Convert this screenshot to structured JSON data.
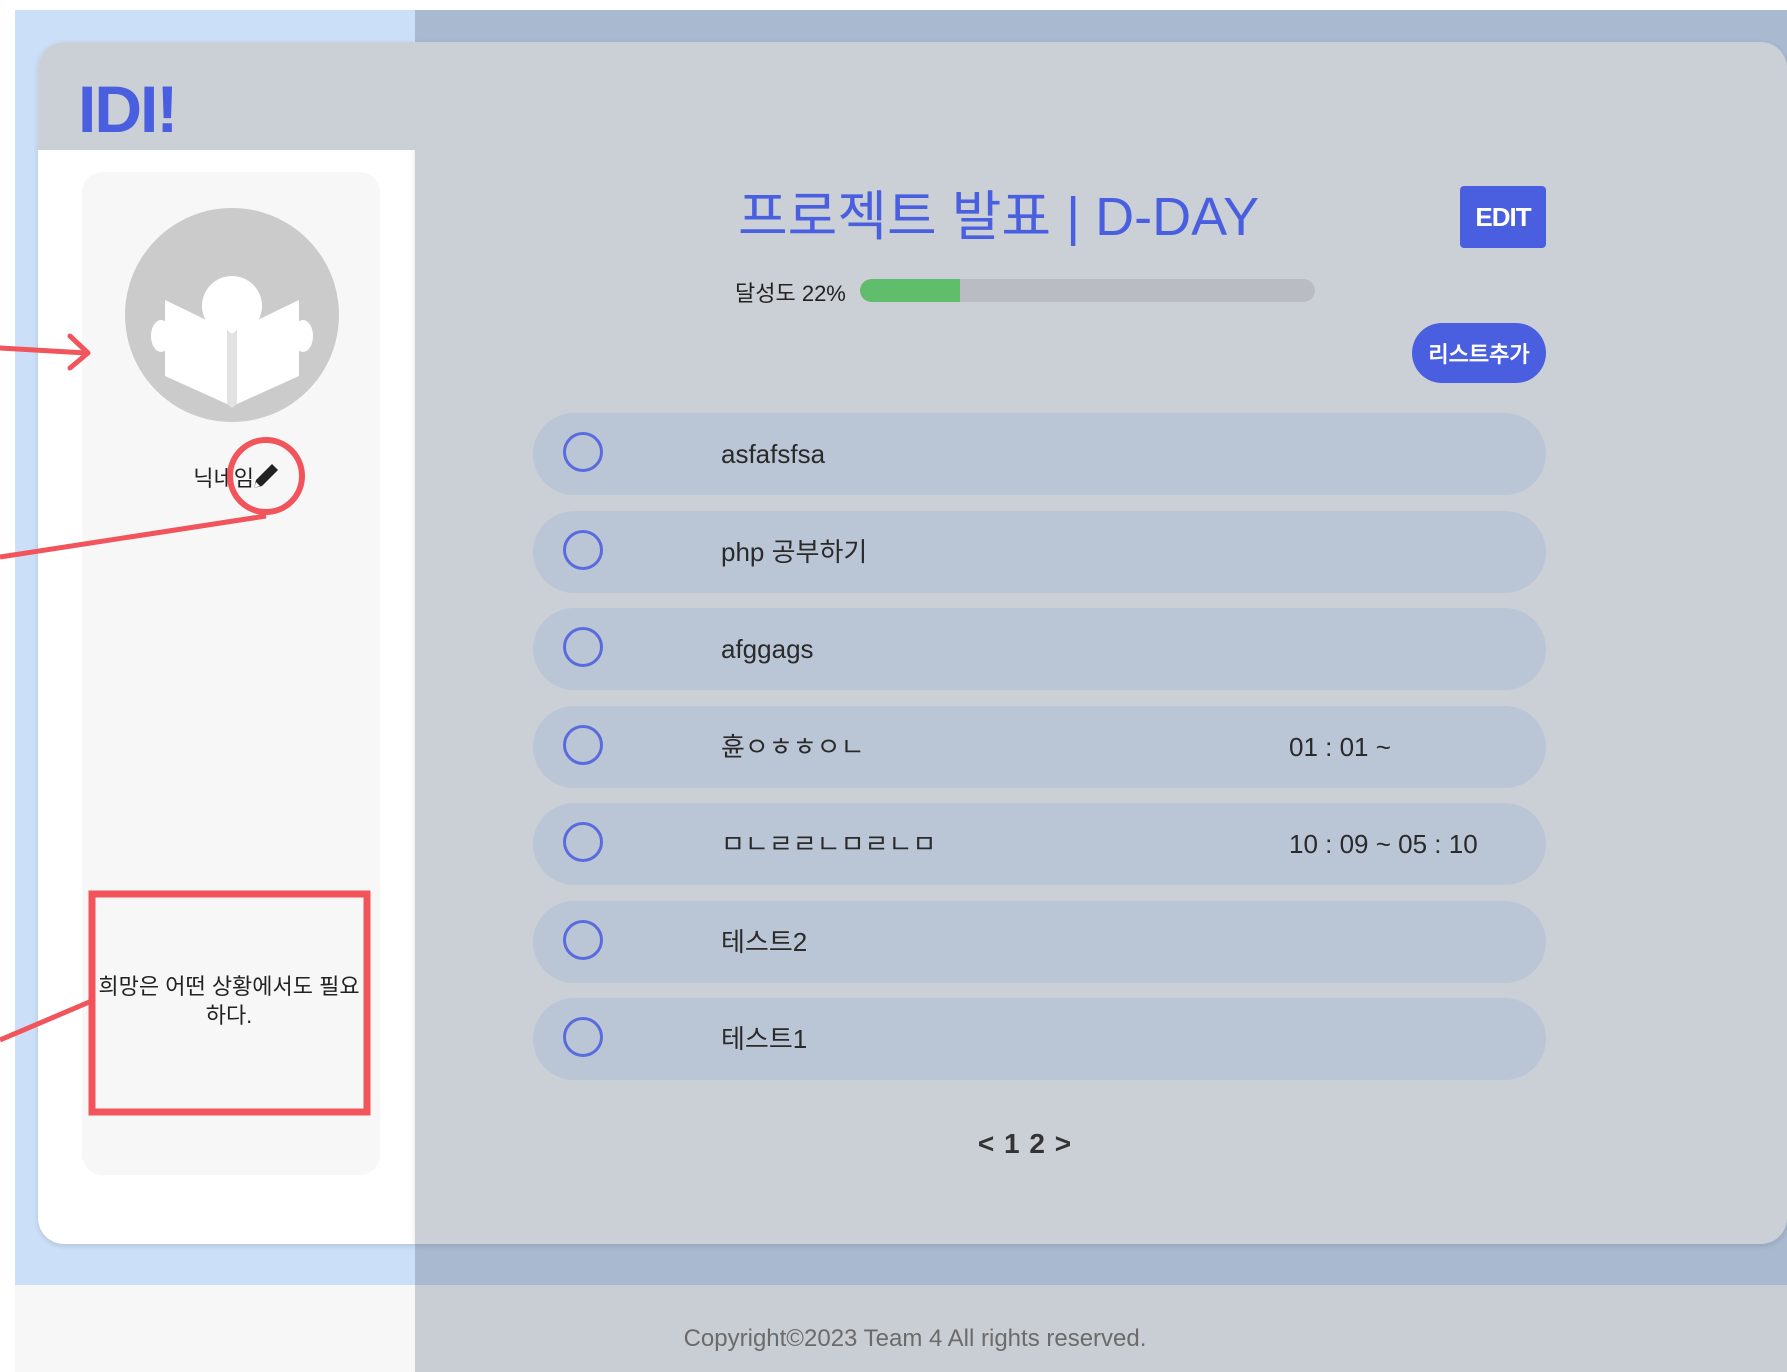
{
  "app": {
    "logo": "IDI!"
  },
  "sidebar": {
    "avatar_icon": "reading-book-icon",
    "nickname": "닉네임",
    "edit_icon": "pencil-icon",
    "quote": "희망은 어떤 상황에서도 필요하다."
  },
  "header": {
    "title": "프로젝트 발표 | D-DAY",
    "edit_label": "EDIT"
  },
  "progress": {
    "label": "달성도 22%",
    "value_percent": 22,
    "fill_color": "#5fbd6c"
  },
  "add_list_label": "리스트추가",
  "todos": [
    {
      "text": "asfafsfsa",
      "time": ""
    },
    {
      "text": "php 공부하기",
      "time": ""
    },
    {
      "text": "afggags",
      "time": ""
    },
    {
      "text": "휸ㅇㅎㅎㅇㄴ",
      "time": "01 : 01  ~"
    },
    {
      "text": "ㅁㄴㄹㄹㄴㅁㄹㄴㅁ",
      "time": "10 : 09  ~  05 : 10"
    },
    {
      "text": "테스트2",
      "time": ""
    },
    {
      "text": "테스트1",
      "time": ""
    }
  ],
  "pagination": "< 1 2 >",
  "footer": {
    "copyright": "Copyright©2023 Team 4 All rights reserved."
  },
  "colors": {
    "accent": "#4a5fe0",
    "annotation": "#f2545b",
    "todo_bg": "#bac6d6"
  }
}
